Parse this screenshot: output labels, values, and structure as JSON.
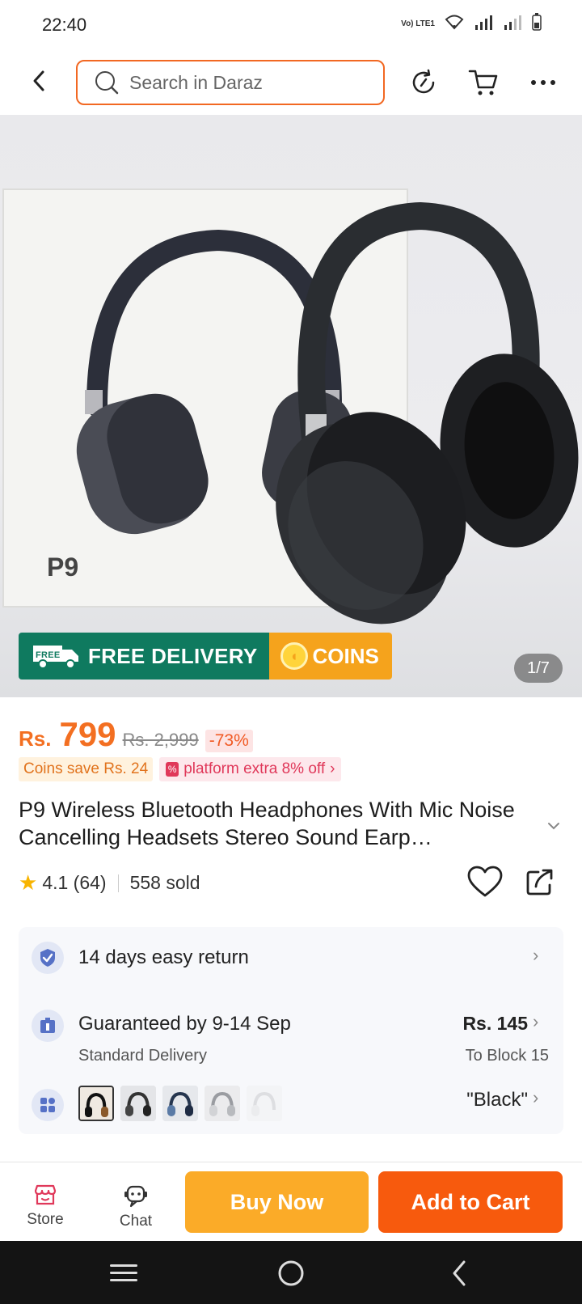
{
  "status_bar": {
    "time": "22:40",
    "network": "Vo) LTE1"
  },
  "header": {
    "search_placeholder": "Search in Daraz",
    "icons": [
      "back-arrow-icon",
      "search-icon",
      "history-icon",
      "cart-icon",
      "more-icon"
    ]
  },
  "gallery": {
    "promo_free": "FREE DELIVERY",
    "promo_coins": "COINS",
    "truck_label": "FREE",
    "counter": "1/7",
    "box_model": "P9"
  },
  "price": {
    "currency": "Rs.",
    "current": "799",
    "original": "Rs. 2,999",
    "discount": "-73%"
  },
  "promos": {
    "coins_save": "Coins save Rs. 24",
    "platform": "platform extra 8% off"
  },
  "product": {
    "title": "P9 Wireless Bluetooth Headphones With Mic Noise Cancelling Headsets Stereo Sound Earp…",
    "rating": "4.1 (64)",
    "sold": "558 sold"
  },
  "service": {
    "return_text": "14 days easy return",
    "delivery_text": "Guaranteed by 9-14 Sep",
    "delivery_sub": "Standard Delivery",
    "delivery_price": "Rs. 145",
    "delivery_location": "To Block 15",
    "variant": "\"Black\""
  },
  "bottom_bar": {
    "store": "Store",
    "chat": "Chat",
    "buy_now": "Buy Now",
    "add_to_cart": "Add to Cart"
  },
  "colors": {
    "brand_orange": "#f75a0d",
    "buy_now": "#fbab28",
    "promo_green": "#0f7a5f",
    "price_orange": "#f36f21"
  }
}
